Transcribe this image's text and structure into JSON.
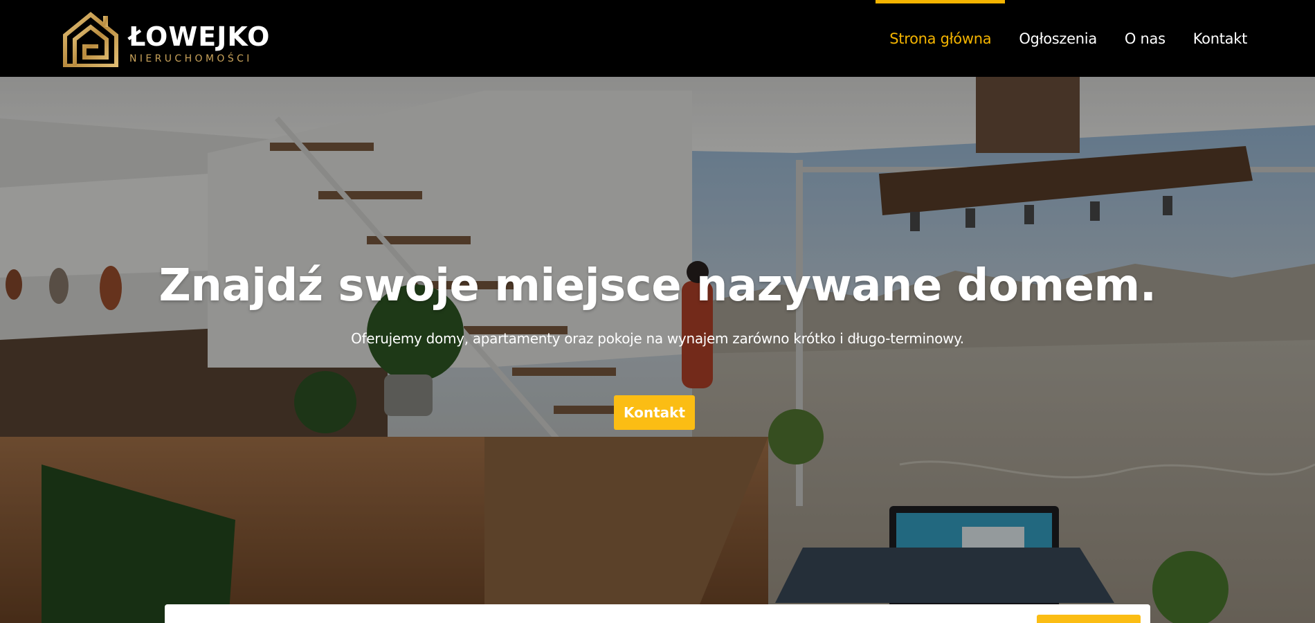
{
  "brand": {
    "name": "ŁOWEJKO",
    "subtitle": "NIERUCHOMOŚCI",
    "gold": "#c9a35b"
  },
  "nav": {
    "items": [
      {
        "label": "Strona główna",
        "active": true
      },
      {
        "label": "Ogłoszenia",
        "active": false
      },
      {
        "label": "O nas",
        "active": false
      },
      {
        "label": "Kontakt",
        "active": false
      }
    ],
    "accent": "#f4b400"
  },
  "hero": {
    "title": "Znajdź swoje miejsce nazywane domem.",
    "subtitle": "Oferujemy domy, apartamenty oraz pokoje na wynajem zarówno krótko i długo-terminowy.",
    "button_label": "Kontakt",
    "button_color": "#fbbd14"
  }
}
